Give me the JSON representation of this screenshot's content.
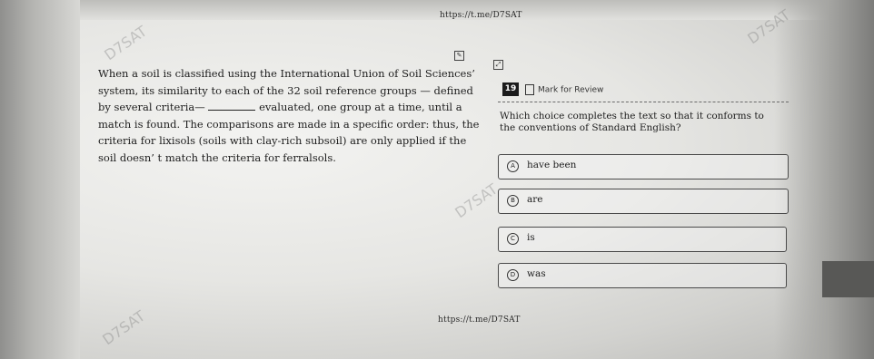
{
  "watermark": {
    "url_top": "https://t.me/D7SAT",
    "url_bottom": "https://t.me/D7SAT",
    "faint_mark": "D7SAT"
  },
  "passage": {
    "before_blank": "When a soil is classified using the International Union of Soil Sciences’  system, its similarity to each of the 32 soil reference groups — defined by several criteria—",
    "after_blank": "evaluated, one group at a time, until a match is found. The comparisons are made in a specific order: thus, the criteria for lixisols (soils with clay-rich subsoil) are only applied if the soil doesn’ t match the criteria for ferralsols."
  },
  "question": {
    "number": "19",
    "mark_for_review": "Mark for Review",
    "prompt": "Which choice completes the text so that it conforms to the conventions of Standard English?"
  },
  "choices": [
    {
      "letter": "A",
      "text": "have been"
    },
    {
      "letter": "B",
      "text": "are"
    },
    {
      "letter": "C",
      "text": "is"
    },
    {
      "letter": "D",
      "text": "was"
    }
  ],
  "icons": {
    "annotate": "annotate-icon",
    "expand": "expand-icon",
    "bookmark": "bookmark-icon"
  }
}
